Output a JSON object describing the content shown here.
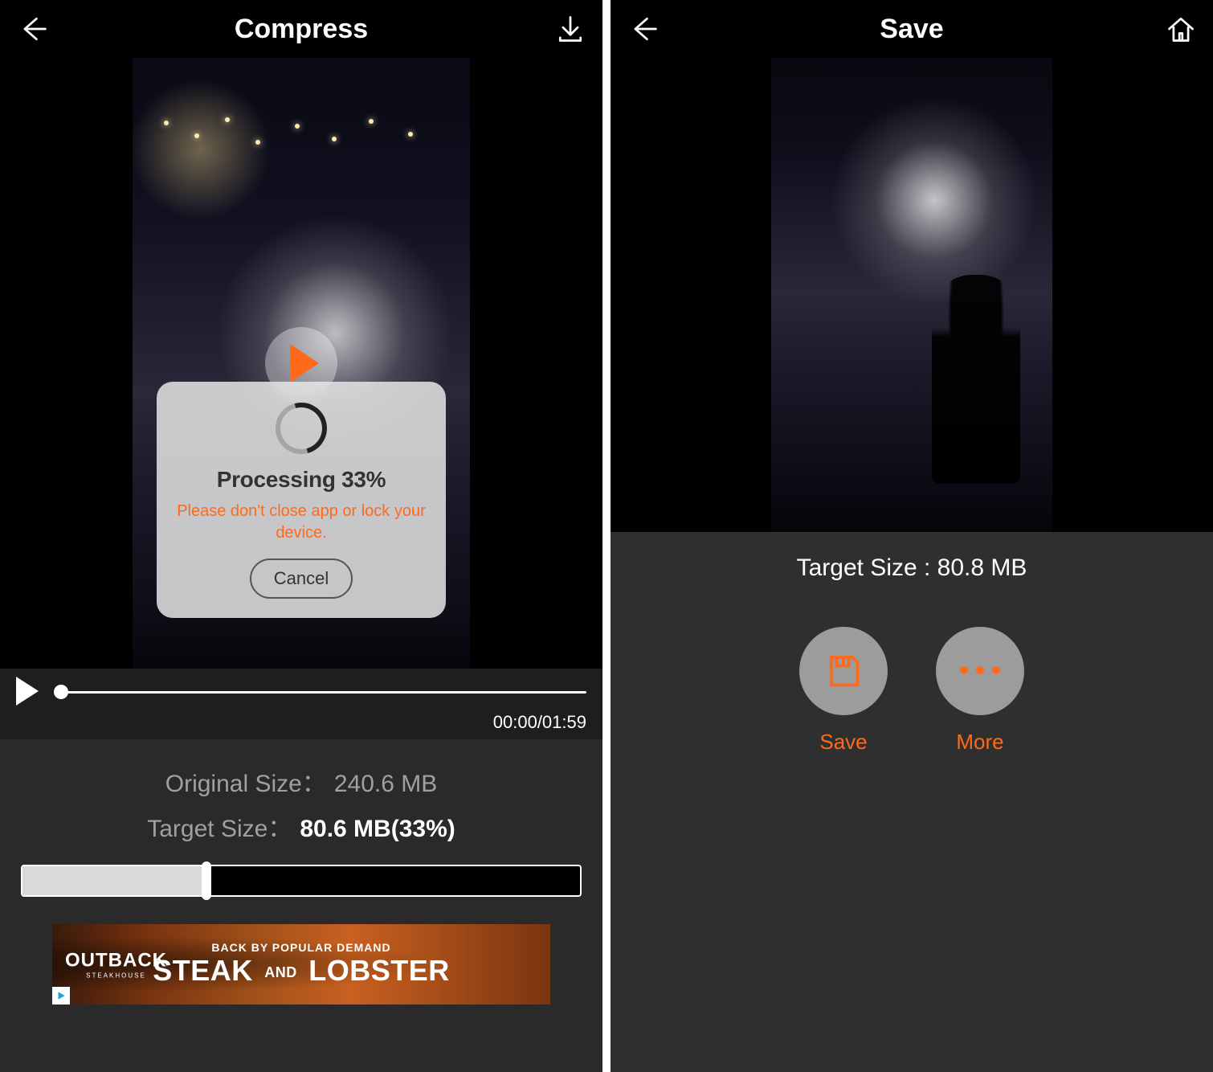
{
  "colors": {
    "accent": "#ff6a1a"
  },
  "left": {
    "header_title": "Compress",
    "modal": {
      "title": "Processing 33%",
      "message": "Please don't close app or lock your device.",
      "cancel_label": "Cancel"
    },
    "playbar": {
      "time": "00:00/01:59"
    },
    "sizes": {
      "original_label": "Original Size：",
      "original_value": "240.6 MB",
      "target_label": "Target Size：",
      "target_value": "80.6 MB(33%)",
      "slider_percent": 33
    },
    "ad": {
      "brand": "OUTBACK",
      "brand_sub": "STEAKHOUSE",
      "top_line": "BACK BY POPULAR DEMAND",
      "main_left": "STEAK",
      "main_and": "AND",
      "main_right": "LOBSTER"
    }
  },
  "right": {
    "header_title": "Save",
    "target_line": "Target Size : 80.8 MB",
    "actions": {
      "save_label": "Save",
      "more_label": "More"
    }
  }
}
